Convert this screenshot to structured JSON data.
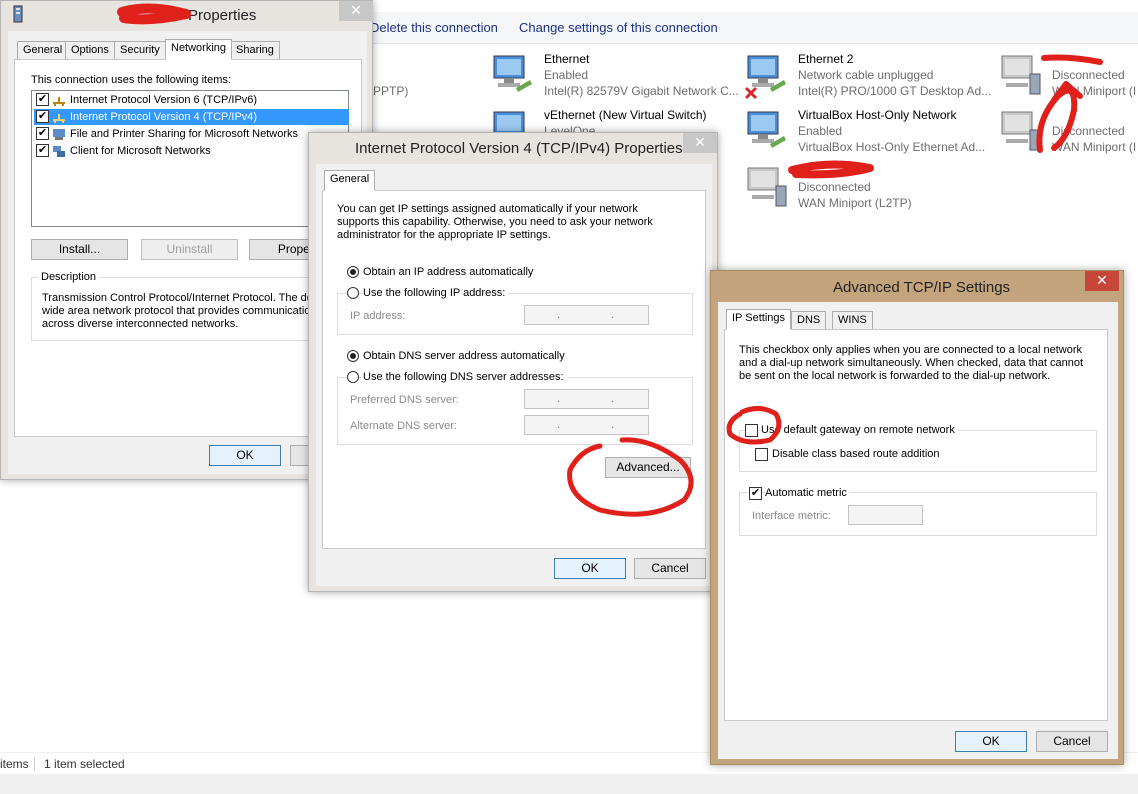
{
  "background": {
    "toolbar": {
      "delete_label": "Delete this connection",
      "change_label": "Change settings of this connection"
    },
    "connections": [
      {
        "name": "Ethernet",
        "status": "Enabled",
        "device": "Intel(R) 82579V Gigabit Network C..."
      },
      {
        "name": "Ethernet 2",
        "status": "Network cable unplugged",
        "device": "Intel(R) PRO/1000 GT Desktop Ad..."
      },
      {
        "name": "",
        "status": "Disconnected",
        "device": "WAN Miniport (I"
      },
      {
        "name": "vEthernet (New Virtual Switch)",
        "status": "LevelOne",
        "device": ""
      },
      {
        "name": "VirtualBox Host-Only Network",
        "status": "Enabled",
        "device": "VirtualBox Host-Only Ethernet Ad..."
      },
      {
        "name": "",
        "status": "Disconnected",
        "device": "WAN Miniport (I"
      },
      {
        "name": "",
        "status": "Disconnected",
        "device": "WAN Miniport (L2TP)"
      }
    ],
    "left_partial_text": "PPTP)",
    "statusbar": {
      "items_text": "items",
      "selected_text": "1 item selected"
    }
  },
  "adapter_props": {
    "title": "Properties",
    "tabs": [
      "General",
      "Options",
      "Security",
      "Networking",
      "Sharing"
    ],
    "active_tab": "Networking",
    "items_label": "This connection uses the following items:",
    "items": [
      {
        "label": "Internet Protocol Version 6 (TCP/IPv6)",
        "checked": "✔"
      },
      {
        "label": "Internet Protocol Version 4 (TCP/IPv4)",
        "checked": "✔"
      },
      {
        "label": "File and Printer Sharing for Microsoft Networks",
        "checked": "✔"
      },
      {
        "label": "Client for Microsoft Networks",
        "checked": "✔"
      }
    ],
    "install_label": "Install...",
    "uninstall_label": "Uninstall",
    "properties_label": "Propert",
    "description_label": "Description",
    "description_text": "Transmission Control Protocol/Internet Protocol. The defa wide area network protocol that provides communication across diverse interconnected networks.",
    "ok_label": "OK"
  },
  "ipv4_props": {
    "title": "Internet Protocol Version 4 (TCP/IPv4) Properties",
    "tab": "General",
    "intro": "You can get IP settings assigned automatically if your network supports this capability. Otherwise, you need to ask your network administrator for the appropriate IP settings.",
    "obtain_ip_auto": "Obtain an IP address automatically",
    "use_following_ip": "Use the following IP address:",
    "ip_address_label": "IP address:",
    "obtain_dns_auto": "Obtain DNS server address automatically",
    "use_following_dns": "Use the following DNS server addresses:",
    "preferred_dns_label": "Preferred DNS server:",
    "alternate_dns_label": "Alternate DNS server:",
    "ip_placeholder": ". . .",
    "advanced_label": "Advanced...",
    "ok_label": "OK",
    "cancel_label": "Cancel"
  },
  "advanced": {
    "title": "Advanced TCP/IP Settings",
    "tabs": [
      "IP Settings",
      "DNS",
      "WINS"
    ],
    "active_tab": "IP Settings",
    "info": "This checkbox only applies when you are connected to a local network and a dial-up network simultaneously.  When checked, data that cannot be sent on the local network is forwarded to the dial-up network.",
    "use_default_gateway": "Use default gateway on remote network",
    "disable_class_route": "Disable class based route addition",
    "automatic_metric": "Automatic metric",
    "automatic_metric_checked": "✔",
    "interface_metric_label": "Interface metric:",
    "ok_label": "OK",
    "cancel_label": "Cancel"
  },
  "colors": {
    "active_frame": "#c4a47c",
    "selection": "#3399ff",
    "annotation_red": "#e0201b",
    "link_blue": "#1e3287"
  }
}
